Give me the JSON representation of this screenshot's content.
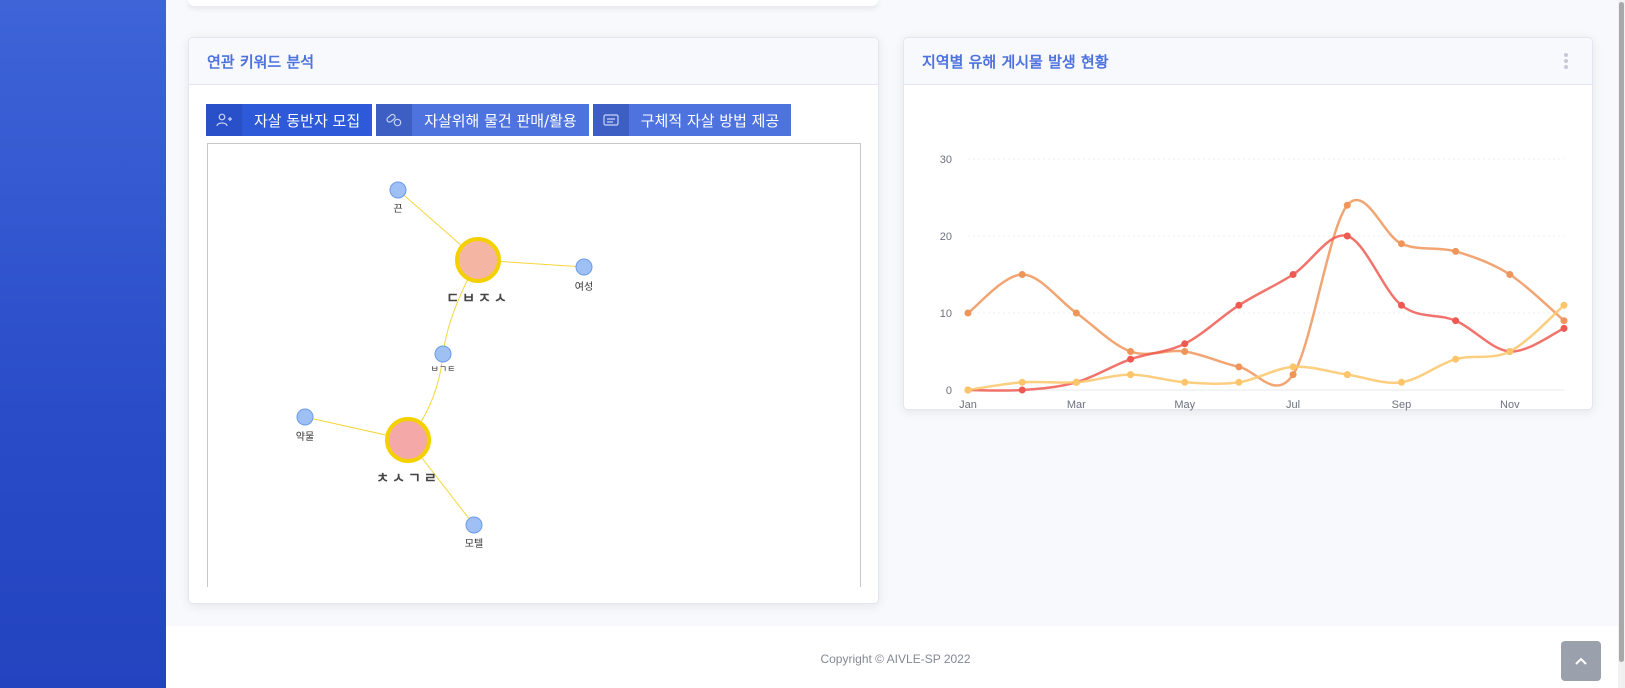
{
  "keyword_card": {
    "title": "연관 키워드 분석",
    "tabs": [
      {
        "label": "자살 동반자 모집",
        "icon": "user-add-icon",
        "active": true
      },
      {
        "label": "자살위해 물건 판매/활용",
        "icon": "pills-icon",
        "active": false
      },
      {
        "label": "구체적 자살 방법 제공",
        "icon": "message-icon",
        "active": false
      }
    ],
    "graph": {
      "nodes": [
        {
          "id": "n1",
          "label": "ㄷㅂㅈㅅ",
          "type": "main"
        },
        {
          "id": "n2",
          "label": "ㅊㅅㄱㄹ",
          "type": "main"
        },
        {
          "id": "n3",
          "label": "끈",
          "type": "sub"
        },
        {
          "id": "n4",
          "label": "여성",
          "type": "sub"
        },
        {
          "id": "n5",
          "label": "ㅂㄱㅌ",
          "type": "sub"
        },
        {
          "id": "n6",
          "label": "약물",
          "type": "sub"
        },
        {
          "id": "n7",
          "label": "모텔",
          "type": "sub"
        }
      ]
    }
  },
  "region_card": {
    "title": "지역별 유해 게시물 발생 현황",
    "menu_icon": "kebab-menu-icon"
  },
  "chart_data": {
    "type": "line",
    "x": [
      "Jan",
      "Feb",
      "Mar",
      "Apr",
      "May",
      "Jun",
      "Jul",
      "Aug",
      "Sep",
      "Oct",
      "Nov",
      "Dec"
    ],
    "x_tick_labels": [
      "Jan",
      "Mar",
      "May",
      "Jul",
      "Sep",
      "Nov"
    ],
    "ylim": [
      0,
      30
    ],
    "y_ticks": [
      0,
      10,
      20,
      30
    ],
    "grid": true,
    "series": [
      {
        "color": "#f0955a",
        "values": [
          10,
          15,
          10,
          5,
          5,
          3,
          2,
          24,
          19,
          18,
          15,
          9
        ]
      },
      {
        "color": "#ee5a52",
        "values": [
          0,
          0,
          1,
          4,
          6,
          11,
          15,
          20,
          11,
          9,
          5,
          8
        ]
      },
      {
        "color": "#fcc56a",
        "values": [
          0,
          1,
          1,
          2,
          1,
          1,
          3,
          2,
          1,
          4,
          5,
          11
        ]
      }
    ]
  },
  "footer": {
    "copyright": "Copyright © AIVLE-SP 2022"
  },
  "colors": {
    "primary": "#4e73df",
    "sidebar": "#2e59d9"
  }
}
